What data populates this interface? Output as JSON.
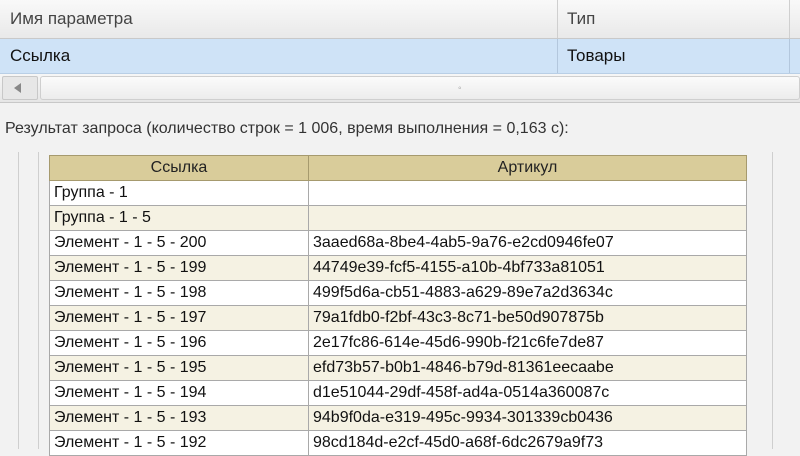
{
  "params": {
    "headers": {
      "name": "Имя параметра",
      "type": "Тип"
    },
    "row": {
      "name": "Ссылка",
      "type": "Товары"
    }
  },
  "result": {
    "caption": "Результат запроса (количество строк = 1 006, время выполнения = 0,163 с):",
    "columns": [
      "Ссылка",
      "Артикул"
    ],
    "rows": [
      [
        "Группа - 1",
        ""
      ],
      [
        "Группа - 1 - 5",
        ""
      ],
      [
        "Элемент - 1 - 5 - 200",
        "3aaed68a-8be4-4ab5-9a76-e2cd0946fe07"
      ],
      [
        "Элемент - 1 - 5 - 199",
        "44749e39-fcf5-4155-a10b-4bf733a81051"
      ],
      [
        "Элемент - 1 - 5 - 198",
        "499f5d6a-cb51-4883-a629-89e7a2d3634c"
      ],
      [
        "Элемент - 1 - 5 - 197",
        "79a1fdb0-f2bf-43c3-8c71-be50d907875b"
      ],
      [
        "Элемент - 1 - 5 - 196",
        "2e17fc86-614e-45d6-990b-f21c6fe7de87"
      ],
      [
        "Элемент - 1 - 5 - 195",
        "efd73b57-b0b1-4846-b79d-81361eecaabe"
      ],
      [
        "Элемент - 1 - 5 - 194",
        "d1e51044-29df-458f-ad4a-0514a360087c"
      ],
      [
        "Элемент - 1 - 5 - 193",
        "94b9f0da-e319-495c-9934-301339cb0436"
      ],
      [
        "Элемент - 1 - 5 - 192",
        "98cd184d-e2cf-45d0-a68f-6dc2679a9f73"
      ]
    ]
  }
}
